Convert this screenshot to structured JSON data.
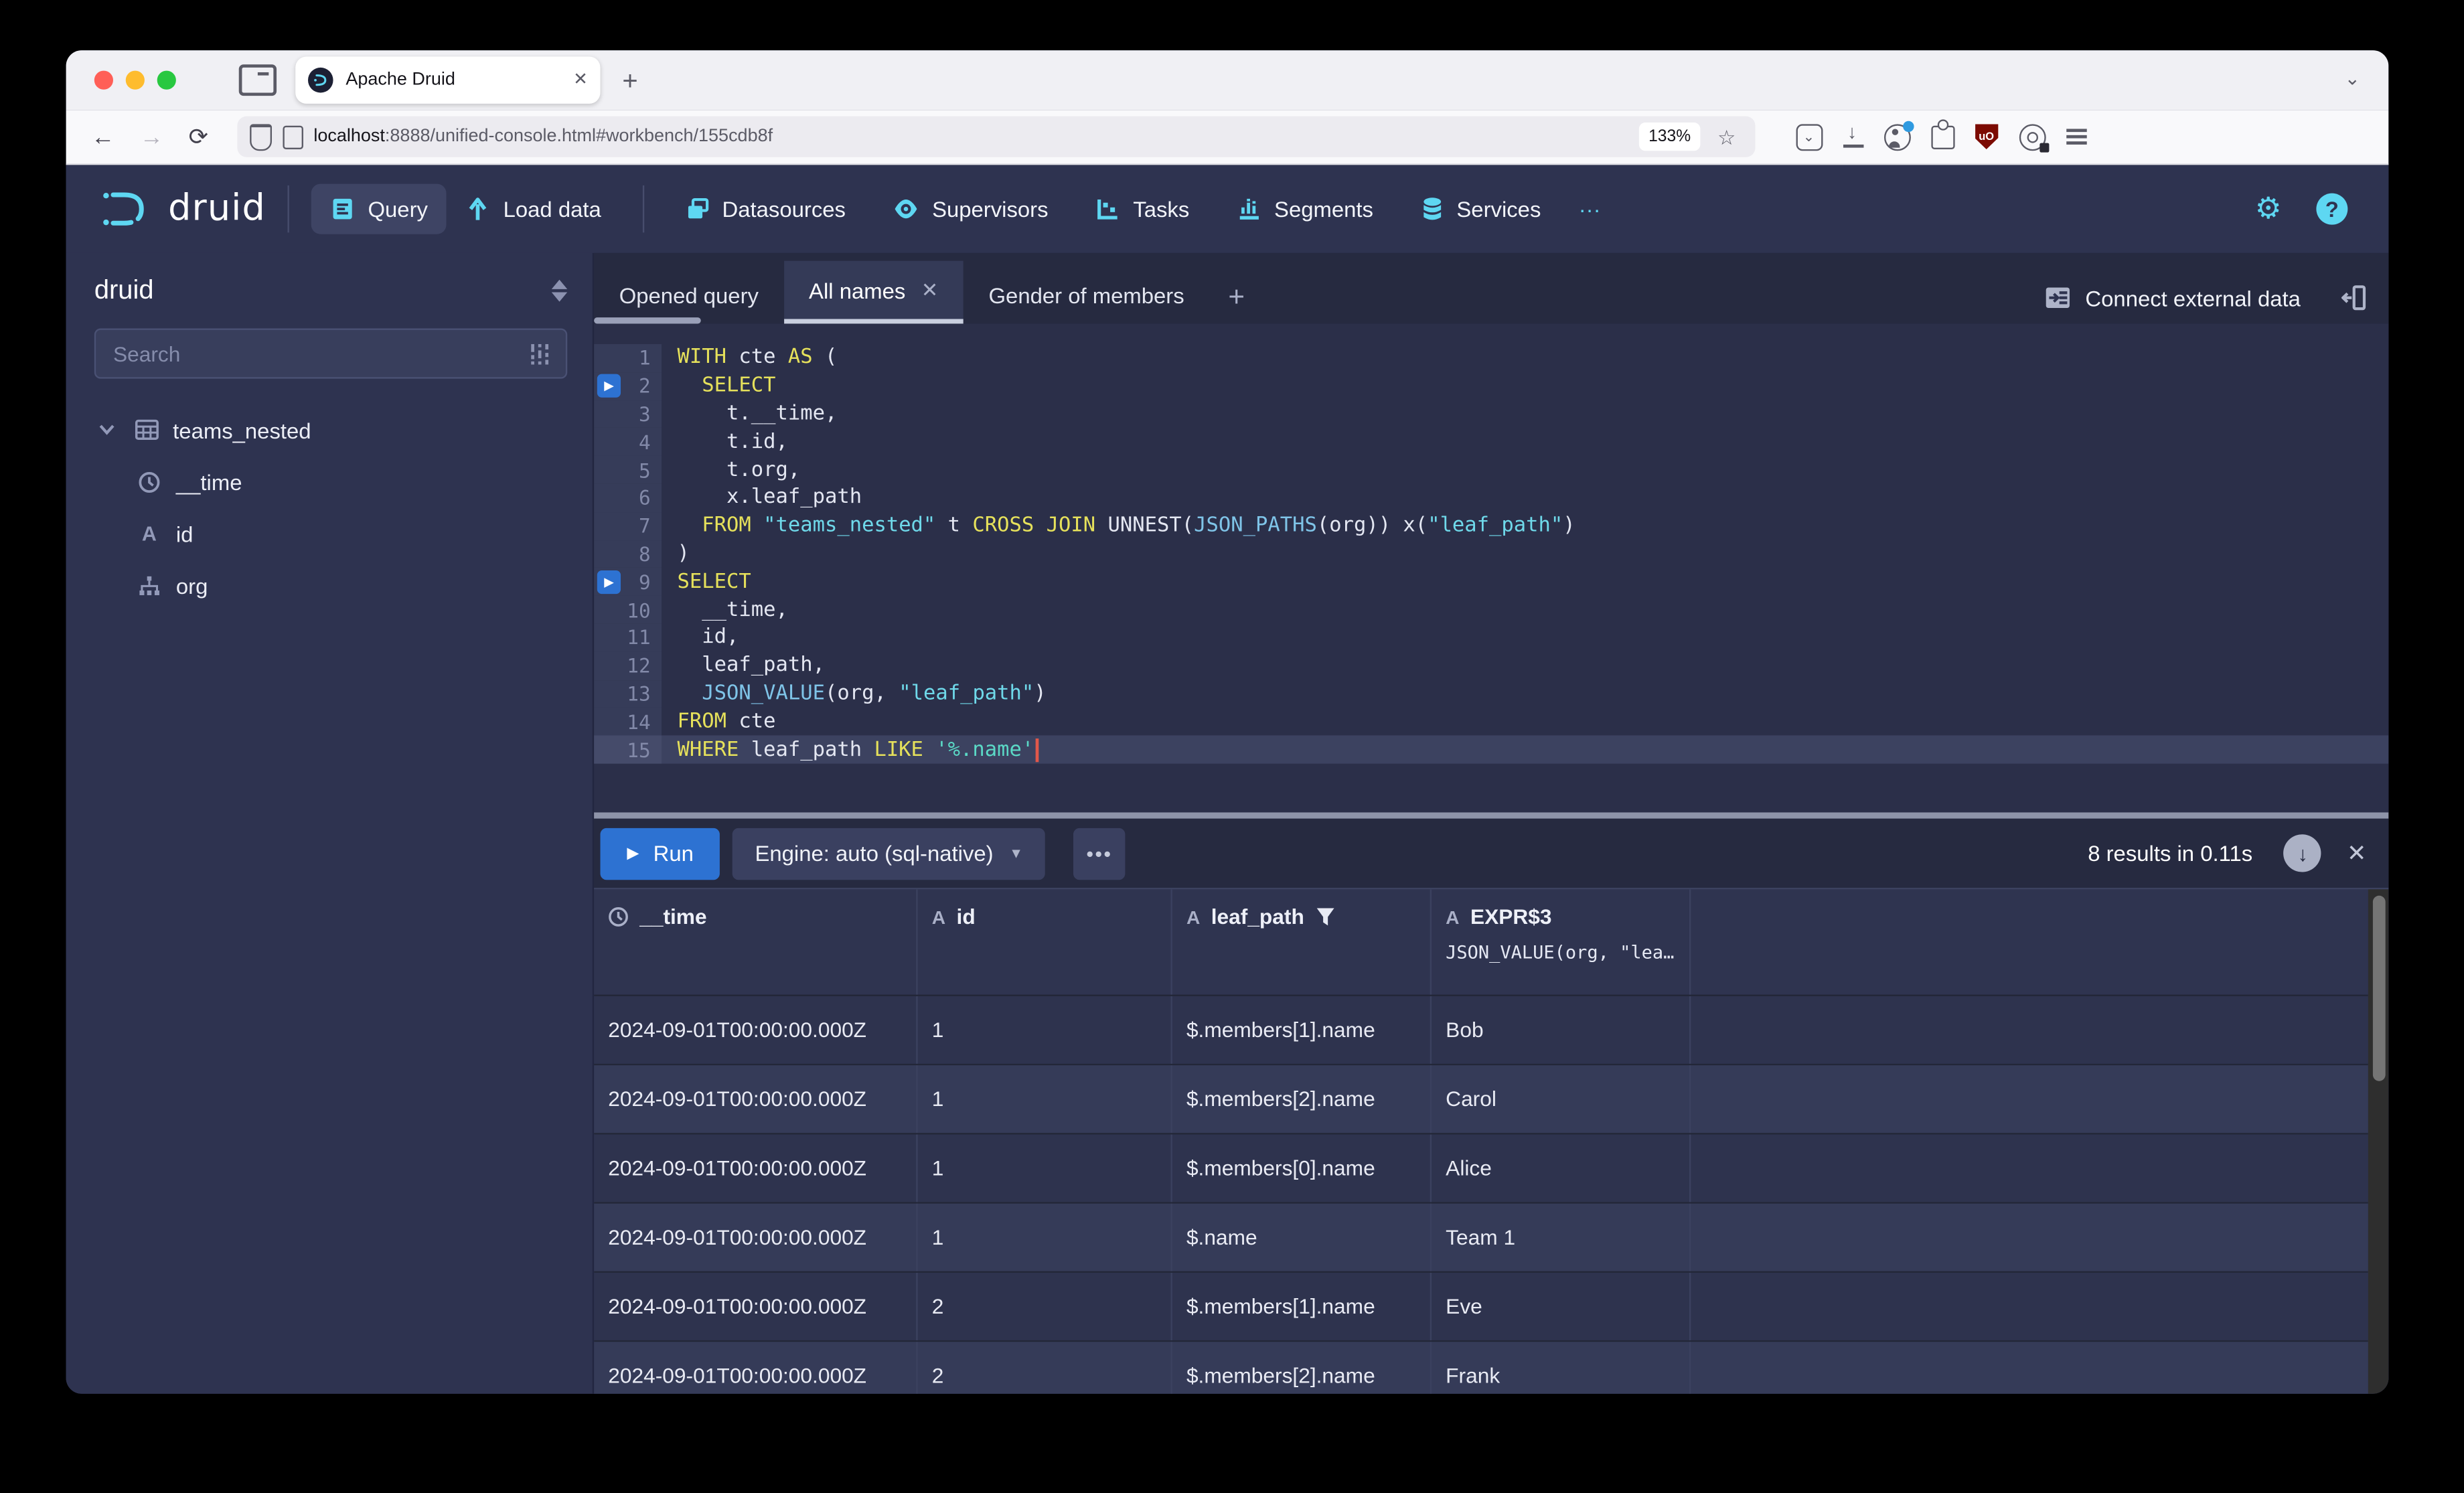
{
  "browser": {
    "tab_title": "Apache Druid",
    "url_host": "localhost",
    "url_rest": ":8888/unified-console.html#workbench/155cdb8f",
    "zoom_level": "133%"
  },
  "colors": {
    "accent_cyan": "#5ed7f2",
    "run_blue": "#2d72d2",
    "keyword_yellow": "#e6e15b",
    "string_cyan": "#6fd9ea",
    "app_bg": "#2e3350"
  },
  "header": {
    "brand": "druid",
    "nav": [
      {
        "label": "Query",
        "active": true
      },
      {
        "label": "Load data"
      },
      {
        "label": "Datasources"
      },
      {
        "label": "Supervisors"
      },
      {
        "label": "Tasks"
      },
      {
        "label": "Segments"
      },
      {
        "label": "Services"
      },
      {
        "label": "···"
      }
    ]
  },
  "sidebar": {
    "schema": "druid",
    "search_placeholder": "Search",
    "table": "teams_nested",
    "columns": [
      {
        "name": "__time",
        "type": "time"
      },
      {
        "name": "id",
        "type": "string"
      },
      {
        "name": "org",
        "type": "nested"
      }
    ]
  },
  "workbench": {
    "tabs": [
      {
        "label": "Opened query"
      },
      {
        "label": "All names",
        "active": true,
        "close": "✕"
      },
      {
        "label": "Gender of members"
      }
    ],
    "add_tab": "+",
    "connect_label": "Connect external data",
    "run_label": "Run",
    "engine_label": "Engine: auto (sql-native)",
    "more_label": "•••",
    "results_summary": "8 results in 0.11s",
    "editor": {
      "lines": [
        {
          "n": 1,
          "segs": [
            {
              "t": "WITH",
              "c": "kw"
            },
            {
              "t": " cte ",
              "c": "pl"
            },
            {
              "t": "AS",
              "c": "kw"
            },
            {
              "t": " (",
              "c": "pl"
            }
          ]
        },
        {
          "n": 2,
          "play": true,
          "segs": [
            {
              "t": "  ",
              "c": "pl"
            },
            {
              "t": "SELECT",
              "c": "kw"
            }
          ]
        },
        {
          "n": 3,
          "segs": [
            {
              "t": "    t.__time,",
              "c": "pl"
            }
          ]
        },
        {
          "n": 4,
          "segs": [
            {
              "t": "    t.id,",
              "c": "pl"
            }
          ]
        },
        {
          "n": 5,
          "segs": [
            {
              "t": "    t.org,",
              "c": "pl"
            }
          ]
        },
        {
          "n": 6,
          "segs": [
            {
              "t": "    x.leaf_path",
              "c": "pl"
            }
          ]
        },
        {
          "n": 7,
          "segs": [
            {
              "t": "  ",
              "c": "pl"
            },
            {
              "t": "FROM",
              "c": "kw"
            },
            {
              "t": " ",
              "c": "pl"
            },
            {
              "t": "\"teams_nested\"",
              "c": "str"
            },
            {
              "t": " t ",
              "c": "pl"
            },
            {
              "t": "CROSS JOIN",
              "c": "kw"
            },
            {
              "t": " UNNEST(",
              "c": "pl"
            },
            {
              "t": "JSON_PATHS",
              "c": "fn"
            },
            {
              "t": "(org)) x(",
              "c": "pl"
            },
            {
              "t": "\"leaf_path\"",
              "c": "str"
            },
            {
              "t": ")",
              "c": "pl"
            }
          ]
        },
        {
          "n": 8,
          "segs": [
            {
              "t": ")",
              "c": "pl"
            }
          ]
        },
        {
          "n": 9,
          "play": true,
          "segs": [
            {
              "t": "SELECT",
              "c": "kw"
            }
          ]
        },
        {
          "n": 10,
          "segs": [
            {
              "t": "  __time,",
              "c": "pl"
            }
          ]
        },
        {
          "n": 11,
          "segs": [
            {
              "t": "  id,",
              "c": "pl"
            }
          ]
        },
        {
          "n": 12,
          "segs": [
            {
              "t": "  leaf_path,",
              "c": "pl"
            }
          ]
        },
        {
          "n": 13,
          "segs": [
            {
              "t": "  ",
              "c": "pl"
            },
            {
              "t": "JSON_VALUE",
              "c": "fn"
            },
            {
              "t": "(org, ",
              "c": "pl"
            },
            {
              "t": "\"leaf_path\"",
              "c": "str"
            },
            {
              "t": ")",
              "c": "pl"
            }
          ]
        },
        {
          "n": 14,
          "segs": [
            {
              "t": "FROM",
              "c": "kw"
            },
            {
              "t": " cte",
              "c": "pl"
            }
          ]
        },
        {
          "n": 15,
          "active": true,
          "cursor": true,
          "segs": [
            {
              "t": "WHERE",
              "c": "kw"
            },
            {
              "t": " leaf_path ",
              "c": "pl"
            },
            {
              "t": "LIKE",
              "c": "kw"
            },
            {
              "t": " ",
              "c": "pl"
            },
            {
              "t": "'%.name'",
              "c": "sq"
            }
          ]
        }
      ]
    }
  },
  "results": {
    "columns": [
      {
        "name": "__time",
        "icon": "time"
      },
      {
        "name": "id",
        "icon": "string"
      },
      {
        "name": "leaf_path",
        "icon": "string",
        "filtered": true
      },
      {
        "name": "EXPR$3",
        "icon": "string",
        "sub": "JSON_VALUE(org, \"lea…"
      }
    ],
    "rows": [
      [
        "2024-09-01T00:00:00.000Z",
        "1",
        "$.members[1].name",
        "Bob"
      ],
      [
        "2024-09-01T00:00:00.000Z",
        "1",
        "$.members[2].name",
        "Carol"
      ],
      [
        "2024-09-01T00:00:00.000Z",
        "1",
        "$.members[0].name",
        "Alice"
      ],
      [
        "2024-09-01T00:00:00.000Z",
        "1",
        "$.name",
        "Team 1"
      ],
      [
        "2024-09-01T00:00:00.000Z",
        "2",
        "$.members[1].name",
        "Eve"
      ],
      [
        "2024-09-01T00:00:00.000Z",
        "2",
        "$.members[2].name",
        "Frank"
      ]
    ]
  }
}
